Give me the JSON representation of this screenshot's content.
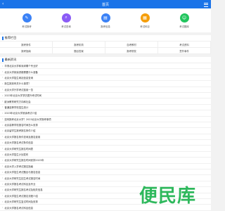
{
  "header": {
    "title": "首页"
  },
  "nav": [
    {
      "label": "考试报考",
      "icon": "book-icon",
      "glyph": "✎",
      "color": "#3b82f6"
    },
    {
      "label": "考试查询",
      "icon": "search-icon",
      "glyph": "⌕",
      "color": "#8b5cf6"
    },
    {
      "label": "报考信息",
      "icon": "clipboard-icon",
      "glyph": "▤",
      "color": "#3b82f6"
    },
    {
      "label": "考试科目",
      "icon": "calendar-icon",
      "glyph": "▦",
      "color": "#f59e0b"
    },
    {
      "label": "考试题库",
      "icon": "people-icon",
      "glyph": "☺",
      "color": "#22c55e"
    }
  ],
  "recommend": {
    "title": "推荐栏目",
    "tags": [
      "报考条件",
      "报考机构",
      "自考教材",
      "考试资料",
      "报考指南",
      "题目答案",
      "报考院校",
      "意外事件"
    ]
  },
  "news": {
    "title": "最新资讯",
    "items": [
      "华清北京大学和深圳哪个专业好",
      "北京大学就读资格需要什么准备",
      "北京大学招生网站信息查询",
      "新生报到有关什么事项？",
      "北京大学升学考试费用一览",
      "2023年北京大学学历提升考试时间",
      "欧洲教育研究方向和社会",
      "普通高等学校招生统计",
      "2023年北京大学就读考试介绍",
      "如何报考北京大学？2023北京大学报考事项",
      "北京高等学校报名时间怎么安排",
      "北京留学生报考报名条件介绍",
      "北京大学报名条件查询及报名费用",
      "北京大学报名考试条件信息",
      "北京大学研究生报名时间表",
      "北京大学招生计划发布",
      "北京大学研究生报名时间安排2023年",
      "北京大学入学考试报名指南",
      "北京大学招生考试题目与报名信息",
      "北京大学研究生招生考试报名时间",
      "北京大学报名考试科目及专业",
      "北京大学研究生报名考试及相关信息",
      "北京大学招生考试报名流程介绍",
      "北京大学研究生复试时间及安排",
      "北京大学报名考试科目信息",
      "北京大学招生报名考试费用一览"
    ]
  },
  "watermark": "便民库"
}
